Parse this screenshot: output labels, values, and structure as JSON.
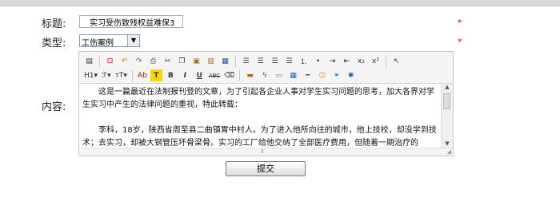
{
  "form": {
    "title_label": "标题:",
    "title_value": "实习受伤致残权益难保3",
    "type_label": "类型:",
    "type_value": "工伤案例",
    "content_label": "内容:",
    "required_mark": "*",
    "submit_label": "提交"
  },
  "toolbar": {
    "row1": [
      "source-icon",
      "fullscreen-icon",
      "undo-icon",
      "redo-icon",
      "print-icon",
      "cut-icon",
      "copy-icon",
      "paste-icon",
      "paste-text-icon",
      "paste-word-icon",
      "align-left-icon",
      "align-center-icon",
      "align-right-icon",
      "align-justify-icon",
      "ordered-list-icon",
      "unordered-list-icon",
      "indent-icon",
      "outdent-icon",
      "subscript-icon",
      "superscript-icon",
      "select-all-icon"
    ],
    "row2_labels": {
      "heading": "H1",
      "font_family": "ℱ",
      "font_size": "тT",
      "font_color": "Ab",
      "highlight": "T",
      "bold": "B",
      "italic": "I",
      "underline": "U",
      "strikethrough": "ABC"
    }
  },
  "editor": {
    "paragraph_1": "这是一篇最近在法制报刊登的文章，为了引起各企业人事对学生实习问题的思考，加大各界对学生实习中产生的法律问题的重视，特此转载：",
    "paragraph_2": "李科，18岁，陕西省周至县二曲镇胃中村人。为了进入他所向往的城市，他上技校，却没学到技术；去实习，却被大钢管压坏骨梁骨。实习的工厂给他交纳了全部医疗费用，但随着一期治疗的"
  }
}
